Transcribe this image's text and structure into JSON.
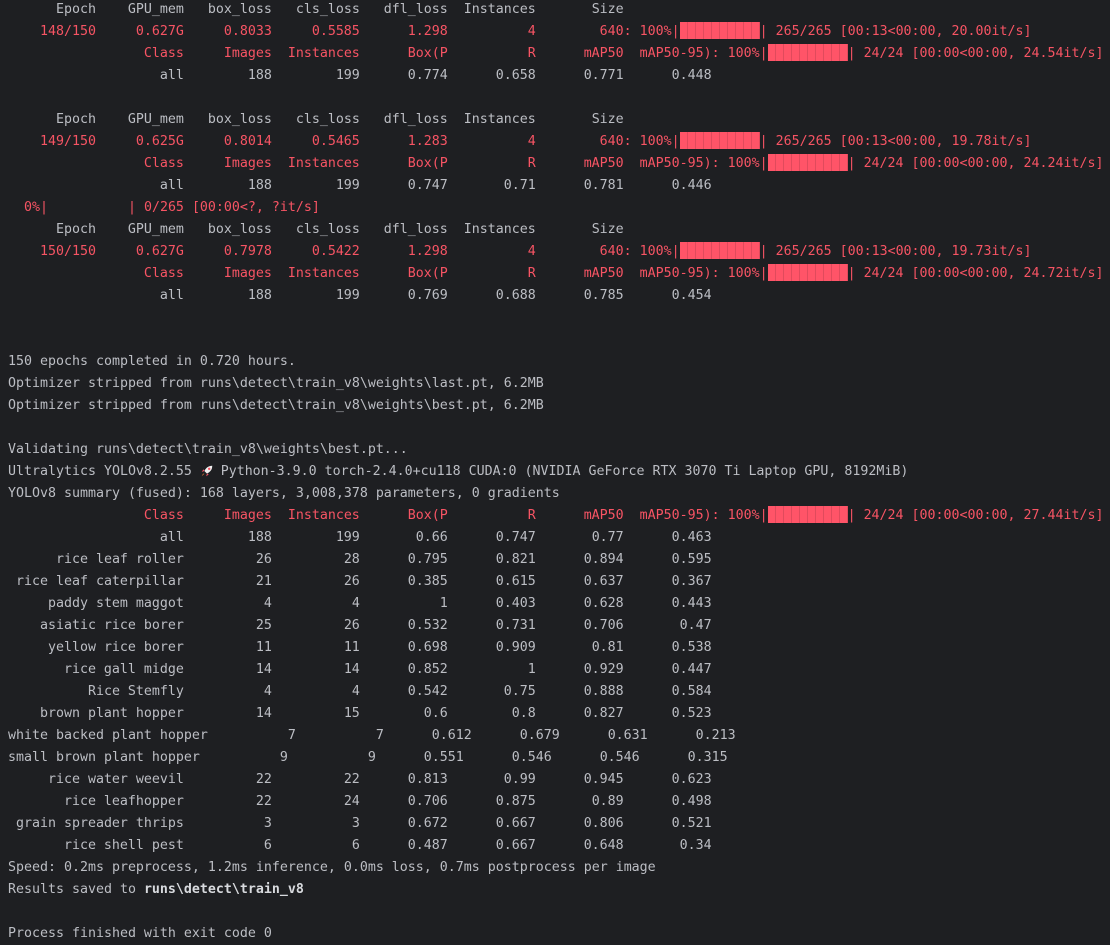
{
  "colors": {
    "background": "#1e1f22",
    "text": "#bcbec4",
    "accent_red": "#f75464"
  },
  "train_header": [
    "Epoch",
    "GPU_mem",
    "box_loss",
    "cls_loss",
    "dfl_loss",
    "Instances",
    "Size"
  ],
  "val_header": [
    "Class",
    "Images",
    "Instances",
    "Box(P",
    "R",
    "mAP50",
    "mAP50-95)"
  ],
  "epochs": [
    {
      "values": [
        "148/150",
        "0.627G",
        "0.8033",
        "0.5585",
        "1.298",
        "4",
        "640"
      ],
      "train_progress": {
        "percent": "100%",
        "fraction": 1.0,
        "count": "265/265",
        "timing": "[00:13<00:00, 20.00it/s]"
      },
      "val_progress": {
        "percent": "100%",
        "fraction": 1.0,
        "count": "24/24",
        "timing": "[00:00<00:00, 24.54it/s]"
      },
      "all": [
        "all",
        "188",
        "199",
        "0.774",
        "0.658",
        "0.771",
        "0.448"
      ]
    },
    {
      "values": [
        "149/150",
        "0.625G",
        "0.8014",
        "0.5465",
        "1.283",
        "4",
        "640"
      ],
      "train_progress": {
        "percent": "100%",
        "fraction": 1.0,
        "count": "265/265",
        "timing": "[00:13<00:00, 19.78it/s]"
      },
      "val_progress": {
        "percent": "100%",
        "fraction": 1.0,
        "count": "24/24",
        "timing": "[00:00<00:00, 24.24it/s]"
      },
      "all": [
        "all",
        "188",
        "199",
        "0.747",
        "0.71",
        "0.781",
        "0.446"
      ]
    },
    {
      "values": [
        "150/150",
        "0.627G",
        "0.7978",
        "0.5422",
        "1.298",
        "4",
        "640"
      ],
      "train_progress": {
        "percent": "100%",
        "fraction": 1.0,
        "count": "265/265",
        "timing": "[00:13<00:00, 19.73it/s]"
      },
      "val_progress": {
        "percent": "100%",
        "fraction": 1.0,
        "count": "24/24",
        "timing": "[00:00<00:00, 24.72it/s]"
      },
      "all": [
        "all",
        "188",
        "199",
        "0.769",
        "0.688",
        "0.785",
        "0.454"
      ]
    }
  ],
  "interim_progress": {
    "percent": "0%",
    "fraction": 0.0,
    "count": "0/265",
    "timing": "[00:00<?, ?it/s]"
  },
  "summary": {
    "completed": "150 epochs completed in 0.720 hours.",
    "stripped_last": "Optimizer stripped from runs\\detect\\train_v8\\weights\\last.pt, 6.2MB",
    "stripped_best": "Optimizer stripped from runs\\detect\\train_v8\\weights\\best.pt, 6.2MB",
    "validating": "Validating runs\\detect\\train_v8\\weights\\best.pt...",
    "ultralytics_version": "Ultralytics YOLOv8.2.55",
    "env": "Python-3.9.0 torch-2.4.0+cu118 CUDA:0 (NVIDIA GeForce RTX 3070 Ti Laptop GPU, 8192MiB)",
    "model_summary": "YOLOv8 summary (fused): 168 layers, 3,008,378 parameters, 0 gradients"
  },
  "final_val": {
    "progress": {
      "percent": "100%",
      "fraction": 1.0,
      "count": "24/24",
      "timing": "[00:00<00:00, 27.44it/s]"
    },
    "rows": [
      [
        "all",
        "188",
        "199",
        "0.66",
        "0.747",
        "0.77",
        "0.463"
      ],
      [
        "rice leaf roller",
        "26",
        "28",
        "0.795",
        "0.821",
        "0.894",
        "0.595"
      ],
      [
        "rice leaf caterpillar",
        "21",
        "26",
        "0.385",
        "0.615",
        "0.637",
        "0.367"
      ],
      [
        "paddy stem maggot",
        "4",
        "4",
        "1",
        "0.403",
        "0.628",
        "0.443"
      ],
      [
        "asiatic rice borer",
        "25",
        "26",
        "0.532",
        "0.731",
        "0.706",
        "0.47"
      ],
      [
        "yellow rice borer",
        "11",
        "11",
        "0.698",
        "0.909",
        "0.81",
        "0.538"
      ],
      [
        "rice gall midge",
        "14",
        "14",
        "0.852",
        "1",
        "0.929",
        "0.447"
      ],
      [
        "Rice Stemfly",
        "4",
        "4",
        "0.542",
        "0.75",
        "0.888",
        "0.584"
      ],
      [
        "brown plant hopper",
        "14",
        "15",
        "0.6",
        "0.8",
        "0.827",
        "0.523"
      ],
      [
        "white backed plant hopper",
        "7",
        "7",
        "0.612",
        "0.679",
        "0.631",
        "0.213"
      ],
      [
        "small brown plant hopper",
        "9",
        "9",
        "0.551",
        "0.546",
        "0.546",
        "0.315"
      ],
      [
        "rice water weevil",
        "22",
        "22",
        "0.813",
        "0.99",
        "0.945",
        "0.623"
      ],
      [
        "rice leafhopper",
        "22",
        "24",
        "0.706",
        "0.875",
        "0.89",
        "0.498"
      ],
      [
        "grain spreader thrips",
        "3",
        "3",
        "0.672",
        "0.667",
        "0.806",
        "0.521"
      ],
      [
        "rice shell pest",
        "6",
        "6",
        "0.487",
        "0.667",
        "0.648",
        "0.34"
      ]
    ]
  },
  "speed": "Speed: 0.2ms preprocess, 1.2ms inference, 0.0ms loss, 0.7ms postprocess per image",
  "results": {
    "prefix": "Results saved to ",
    "path": "runs\\detect\\train_v8"
  },
  "exit": "Process finished with exit code 0"
}
